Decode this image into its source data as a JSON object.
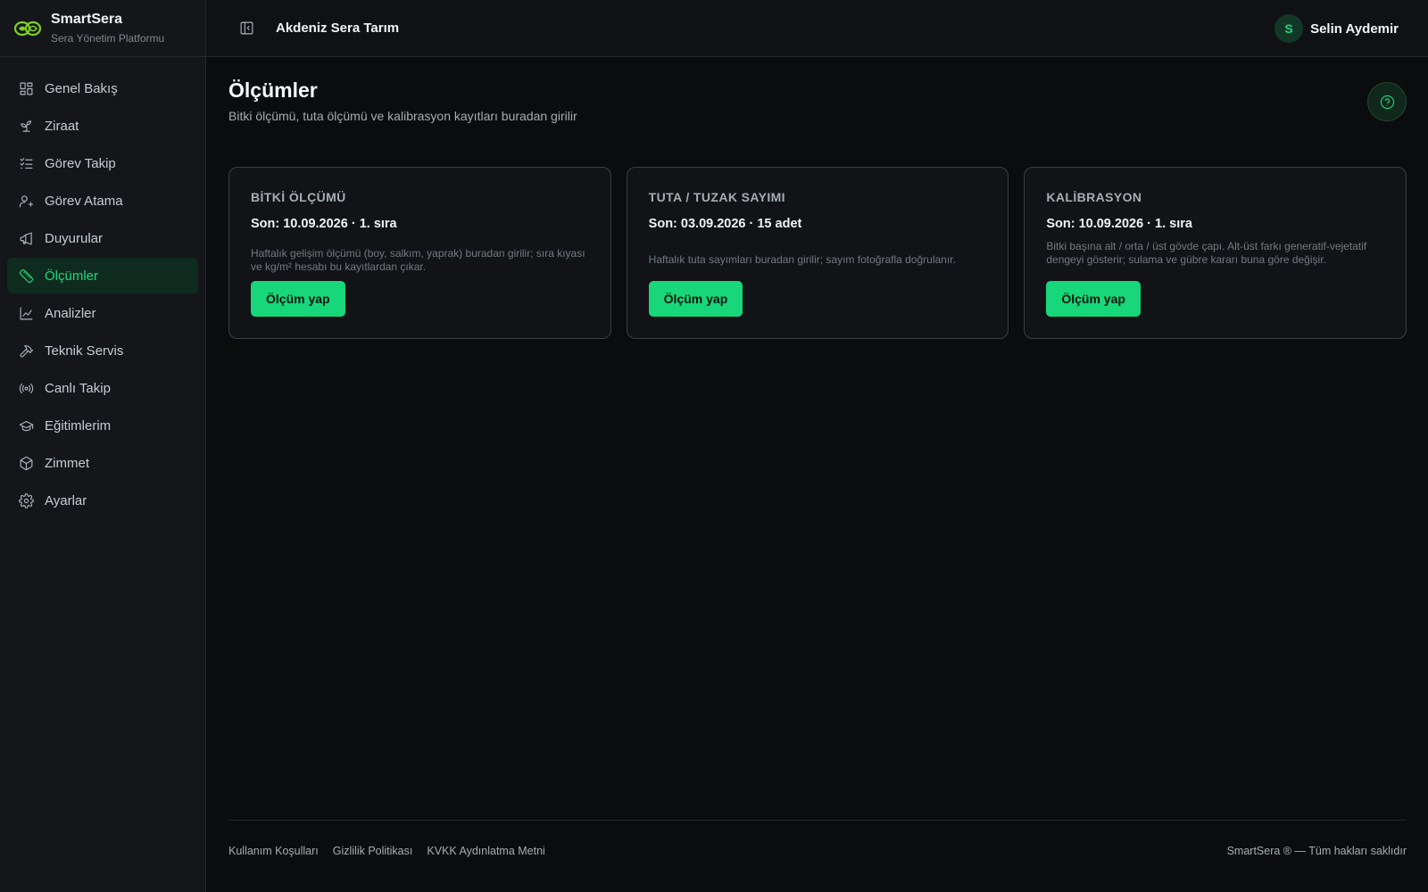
{
  "brand": {
    "name": "SmartSera",
    "subtitle": "Sera Yönetim Platformu"
  },
  "sidebar": {
    "items": [
      {
        "label": "Genel Bakış",
        "icon": "dashboard-icon"
      },
      {
        "label": "Ziraat",
        "icon": "sprout-icon"
      },
      {
        "label": "Görev Takip",
        "icon": "checklist-icon"
      },
      {
        "label": "Görev Atama",
        "icon": "user-plus-icon"
      },
      {
        "label": "Duyurular",
        "icon": "megaphone-icon"
      },
      {
        "label": "Ölçümler",
        "icon": "ruler-icon",
        "active": true
      },
      {
        "label": "Analizler",
        "icon": "line-chart-icon"
      },
      {
        "label": "Teknik Servis",
        "icon": "hammer-icon"
      },
      {
        "label": "Canlı Takip",
        "icon": "radio-icon"
      },
      {
        "label": "Eğitimlerim",
        "icon": "graduation-cap-icon"
      },
      {
        "label": "Zimmet",
        "icon": "box-icon"
      },
      {
        "label": "Ayarlar",
        "icon": "gear-icon"
      }
    ]
  },
  "header": {
    "org_name": "Akdeniz Sera Tarım",
    "user_initial": "S",
    "user_name": "Selin Aydemir"
  },
  "page": {
    "title": "Ölçümler",
    "subtitle": "Bitki ölçümü, tuta ölçümü ve kalibrasyon kayıtları buradan girilir"
  },
  "cards": [
    {
      "title": "BİTKİ ÖLÇÜMÜ",
      "meta": "Son: 10.09.2026 · 1. sıra",
      "description": "Haftalık gelişim ölçümü (boy, salkım, yaprak) buradan girilir; sıra kıyası ve kg/m² hesabı bu kayıtlardan çıkar.",
      "button": "Ölçüm yap"
    },
    {
      "title": "TUTA / TUZAK SAYIMI",
      "meta": "Son: 03.09.2026 · 15 adet",
      "description": "Haftalık tuta sayımları buradan girilir; sayım fotoğrafla doğrulanır.",
      "button": "Ölçüm yap"
    },
    {
      "title": "KALİBRASYON",
      "meta": "Son: 10.09.2026 · 1. sıra",
      "description": "Bitki başına alt / orta / üst gövde çapı. Alt-üst farkı generatif-vejetatif dengeyi gösterir; sulama ve gübre kararı buna göre değişir.",
      "button": "Ölçüm yap"
    }
  ],
  "footer": {
    "links": [
      "Kullanım Koşulları",
      "Gizlilik Politikası",
      "KVKK Aydınlatma Metni"
    ],
    "copyright": "SmartSera ® — Tüm hakları saklıdır"
  },
  "colors": {
    "accent": "#17d77a",
    "background": "#0b0c0e",
    "sidebar": "#14161a"
  }
}
